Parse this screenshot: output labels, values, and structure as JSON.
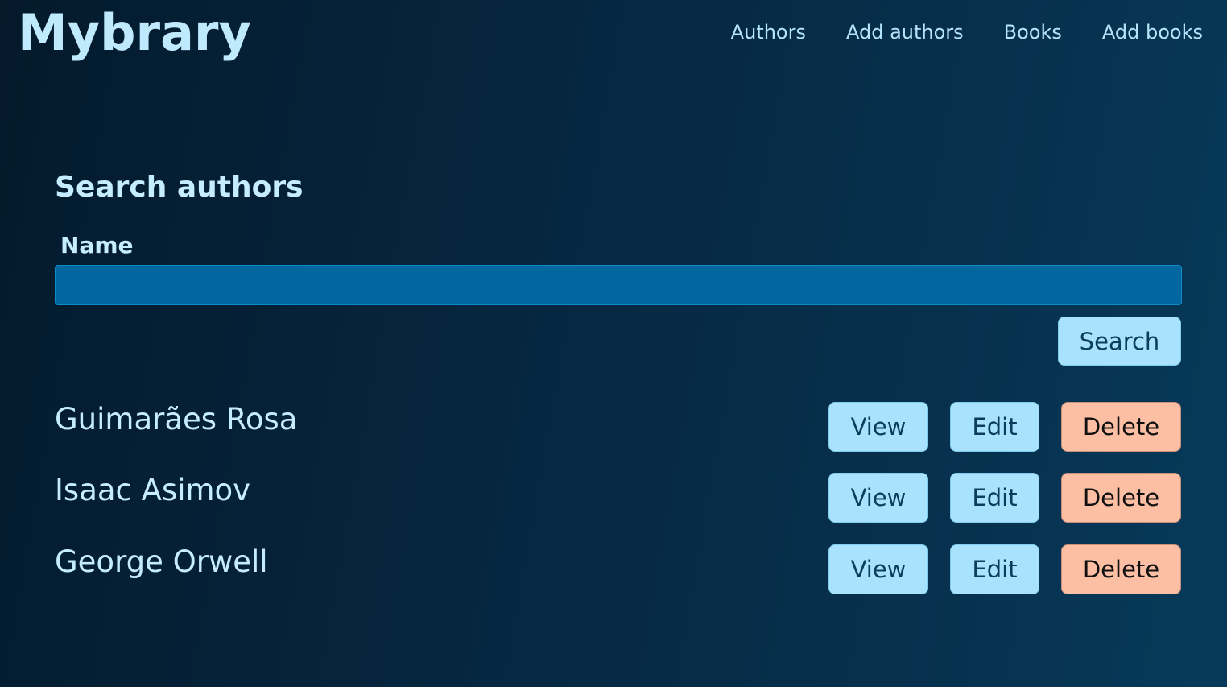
{
  "header": {
    "logo": "Mybrary",
    "nav": [
      "Authors",
      "Add authors",
      "Books",
      "Add books"
    ]
  },
  "search": {
    "title": "Search authors",
    "name_label": "Name",
    "name_value": "",
    "button_label": "Search"
  },
  "authors": [
    {
      "name": "Guimarães Rosa",
      "view": "View",
      "edit": "Edit",
      "delete": "Delete"
    },
    {
      "name": "Isaac Asimov",
      "view": "View",
      "edit": "Edit",
      "delete": "Delete"
    },
    {
      "name": "George Orwell",
      "view": "View",
      "edit": "Edit",
      "delete": "Delete"
    }
  ],
  "colors": {
    "background": "#062741",
    "accent_button": "#a9e2fc",
    "danger_button": "#fcbfa3",
    "input_bg": "#02679e"
  }
}
